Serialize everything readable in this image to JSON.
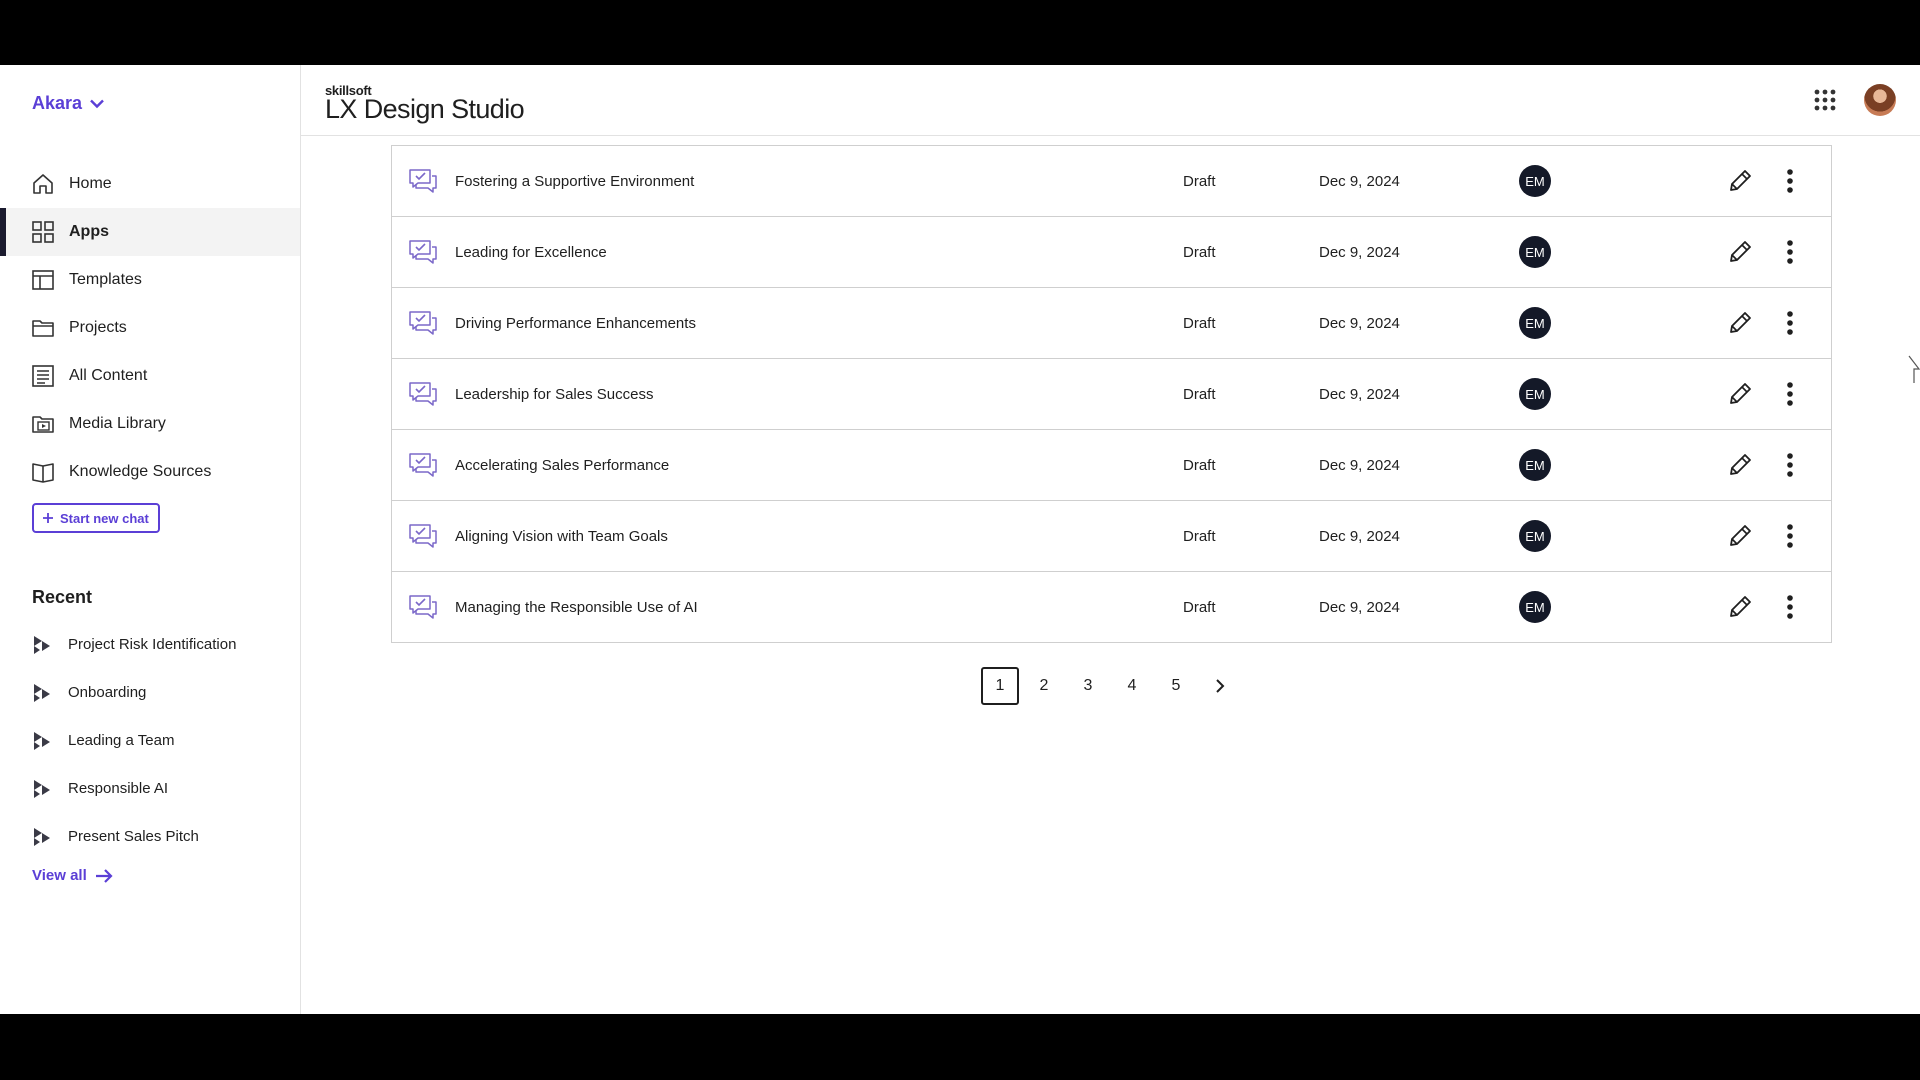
{
  "sidebar": {
    "workspace": "Akara",
    "nav": [
      {
        "label": "Home",
        "icon": "home-icon"
      },
      {
        "label": "Apps",
        "icon": "apps-icon",
        "active": true
      },
      {
        "label": "Templates",
        "icon": "templates-icon"
      },
      {
        "label": "Projects",
        "icon": "folder-icon"
      },
      {
        "label": "All Content",
        "icon": "content-icon"
      },
      {
        "label": "Media Library",
        "icon": "media-icon"
      },
      {
        "label": "Knowledge Sources",
        "icon": "book-icon"
      }
    ],
    "start_chat": "Start new chat",
    "recent_title": "Recent",
    "recent": [
      "Project Risk Identification",
      "Onboarding",
      "Leading a Team",
      "Responsible AI",
      "Present Sales Pitch"
    ],
    "view_all": "View all"
  },
  "header": {
    "brand_small": "skillsoft",
    "brand_big": "LX Design Studio"
  },
  "rows": [
    {
      "title": "Fostering a Supportive Environment",
      "status": "Draft",
      "date": "Dec 9, 2024",
      "owner": "EM"
    },
    {
      "title": "Leading for Excellence",
      "status": "Draft",
      "date": "Dec 9, 2024",
      "owner": "EM"
    },
    {
      "title": "Driving Performance Enhancements",
      "status": "Draft",
      "date": "Dec 9, 2024",
      "owner": "EM"
    },
    {
      "title": "Leadership for Sales Success",
      "status": "Draft",
      "date": "Dec 9, 2024",
      "owner": "EM"
    },
    {
      "title": "Accelerating Sales Performance",
      "status": "Draft",
      "date": "Dec 9, 2024",
      "owner": "EM"
    },
    {
      "title": "Aligning Vision with Team Goals",
      "status": "Draft",
      "date": "Dec 9, 2024",
      "owner": "EM"
    },
    {
      "title": "Managing the Responsible Use of AI",
      "status": "Draft",
      "date": "Dec 9, 2024",
      "owner": "EM"
    }
  ],
  "pagination": {
    "pages": [
      "1",
      "2",
      "3",
      "4",
      "5"
    ],
    "current": "1"
  },
  "colors": {
    "accent": "#5b3fd6",
    "owner_badge": "#141928"
  }
}
